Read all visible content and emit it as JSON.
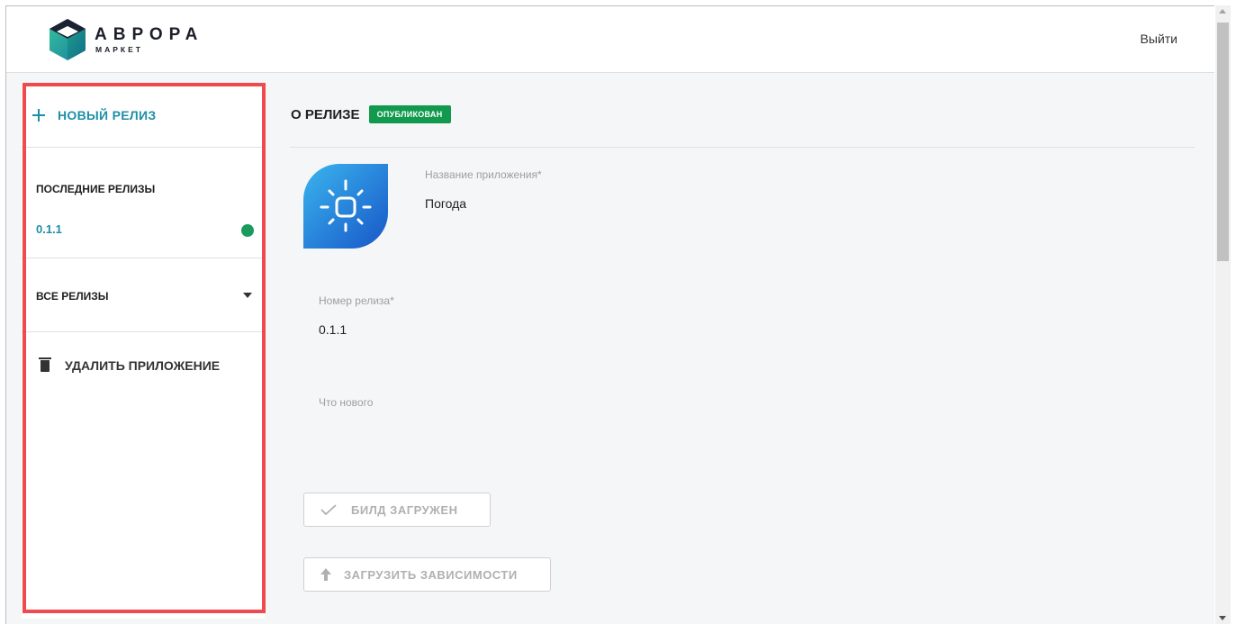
{
  "header": {
    "logo_title": "АВРОРА",
    "logo_subtitle": "МАРКЕТ",
    "logout_label": "Выйти"
  },
  "sidebar": {
    "new_release_label": "НОВЫЙ РЕЛИЗ",
    "recent_title": "ПОСЛЕДНИЕ РЕЛИЗЫ",
    "recent_releases": [
      {
        "version": "0.1.1",
        "status_color": "#1a9a5c"
      }
    ],
    "all_releases_label": "ВСЕ РЕЛИЗЫ",
    "delete_app_label": "УДАЛИТЬ ПРИЛОЖЕНИЕ"
  },
  "main": {
    "title": "О РЕЛИЗЕ",
    "status_badge": "ОПУБЛИКОВАН",
    "app_name_label": "Название приложения*",
    "app_name_value": "Погода",
    "release_number_label": "Номер релиза*",
    "release_number_value": "0.1.1",
    "whats_new_label": "Что нового",
    "build_button_label": "БИЛД ЗАГРУЖЕН",
    "deps_button_label": "ЗАГРУЗИТЬ ЗАВИСИМОСТИ"
  },
  "colors": {
    "accent": "#1e8fa6",
    "published_badge": "#119a4e",
    "highlight_border": "#f04a4f"
  }
}
